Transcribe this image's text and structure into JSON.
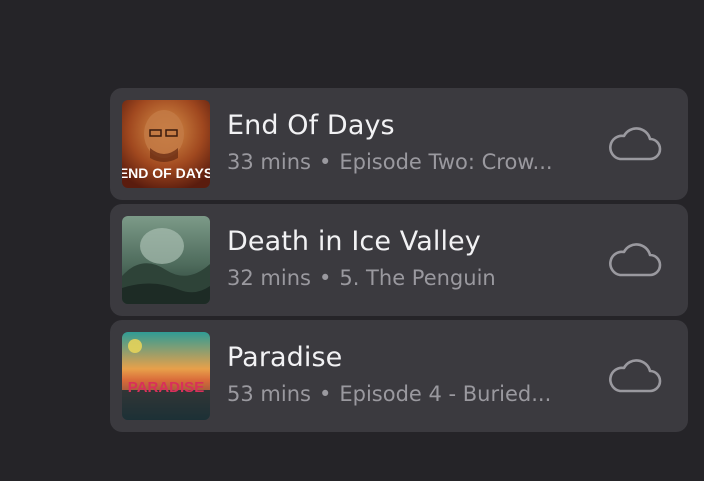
{
  "episodes": [
    {
      "title": "End Of Days",
      "duration": "33 mins",
      "separator": "•",
      "subtitle": "Episode Two: Crow...",
      "artwork_text": "END OF DAYS",
      "status_icon": "cloud-download-icon"
    },
    {
      "title": "Death in Ice Valley",
      "duration": "32 mins",
      "separator": "•",
      "subtitle": "5. The Penguin",
      "status_icon": "cloud-download-icon"
    },
    {
      "title": "Paradise",
      "duration": "53 mins",
      "separator": "•",
      "subtitle": "Episode 4 - Buried...",
      "artwork_text": "PARADISE",
      "status_icon": "cloud-download-icon"
    }
  ],
  "colors": {
    "background": "#252428",
    "row_background": "#3b3a3f",
    "title": "#f2f2f4",
    "meta": "#9a999f",
    "icon": "#9a999f"
  }
}
